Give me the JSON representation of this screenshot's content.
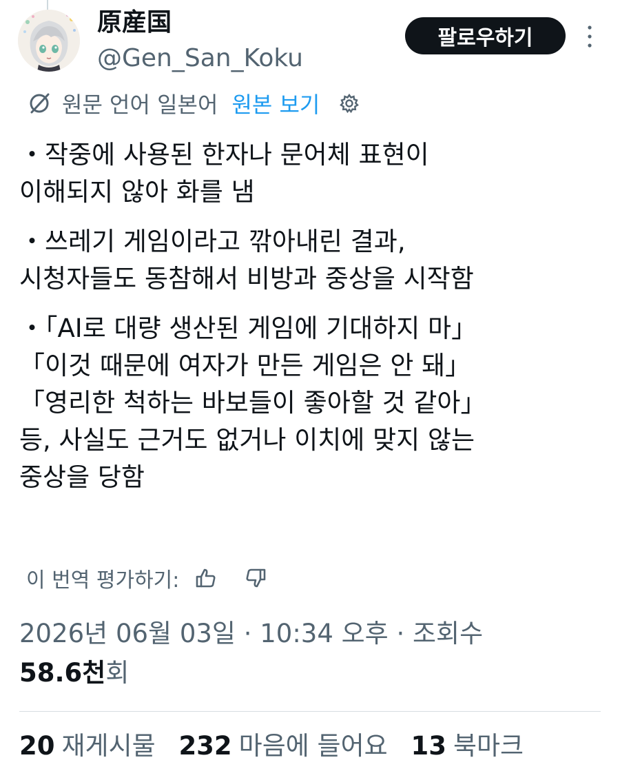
{
  "user": {
    "display_name": "原産国",
    "handle": "@Gen_San_Koku"
  },
  "header": {
    "follow_label": "팔로우하기",
    "more_icon": "more-vertical-icon"
  },
  "translation": {
    "icon": "translate-icon",
    "source_language": "원문 언어 일본어",
    "view_original": "원본 보기",
    "settings_icon": "gear-icon"
  },
  "tweet": {
    "paragraphs": [
      {
        "lines": [
          "・작중에 사용된 한자나 문어체 표현이",
          "이해되지 않아 화를 냄"
        ]
      },
      {
        "lines": [
          "・쓰레기 게임이라고 깎아내린 결과,",
          "시청자들도 동참해서 비방과 중상을 시작함"
        ]
      },
      {
        "lines": [
          "・「AI로 대량 생산된 게임에 기대하지 마」",
          "「이것 때문에 여자가 만든 게임은 안 돼」",
          "「영리한 척하는 바보들이 좋아할 것 같아」",
          "등, 사실도 근거도 없거나 이치에 맞지 않는",
          "중상을 당함"
        ]
      }
    ]
  },
  "rate": {
    "label": "이 번역 평가하기:",
    "thumbs_up_icon": "thumbs-up-icon",
    "thumbs_down_icon": "thumbs-down-icon"
  },
  "meta": {
    "timestamp": "2026년 06월 03일 · 10:34 오후 · 조회수",
    "views_number": "58.6천",
    "views_unit": "회"
  },
  "stats": [
    {
      "count": "20",
      "label": "재게시물"
    },
    {
      "count": "232",
      "label": "마음에 들어요"
    },
    {
      "count": "13",
      "label": "북마크"
    }
  ],
  "colors": {
    "text": "#0f1419",
    "secondary": "#536471",
    "link": "#1d9bf0",
    "button_bg": "#0f1419"
  }
}
